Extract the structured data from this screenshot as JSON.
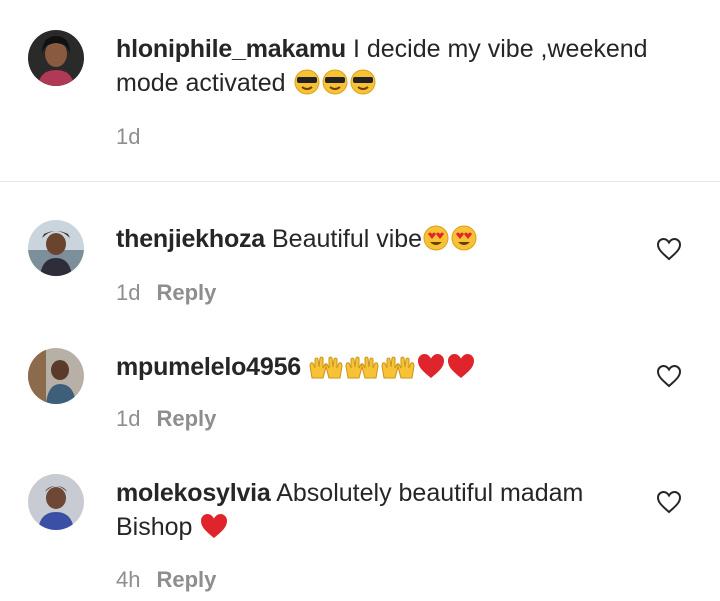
{
  "comments": [
    {
      "username": "hloniphile_makamu",
      "text": "I decide my vibe ,weekend",
      "text_line2": "mode activated",
      "emojis": [
        "sunglasses-emoji",
        "sunglasses-emoji",
        "sunglasses-emoji"
      ],
      "time": "1d",
      "reply": ""
    },
    {
      "username": "thenjiekhoza",
      "text": "Beautiful vibe",
      "emojis": [
        "heart-eyes-emoji",
        "heart-eyes-emoji"
      ],
      "time": "1d",
      "reply": "Reply"
    },
    {
      "username": "mpumelelo4956",
      "text": "",
      "emojis": [
        "raising-hands-emoji",
        "raising-hands-emoji",
        "raising-hands-emoji",
        "red-heart-emoji",
        "red-heart-emoji"
      ],
      "time": "1d",
      "reply": "Reply"
    },
    {
      "username": "molekosylvia",
      "text": "Absolutely beautiful madam",
      "text_line2": "Bishop",
      "emojis": [
        "red-heart-emoji"
      ],
      "time": "4h",
      "reply": "Reply"
    }
  ],
  "icons": {
    "like": "heart-outline-icon"
  },
  "colors": {
    "text": "#262626",
    "secondary": "#8e8e8e",
    "divider": "#e6e6e6",
    "emoji_yellow": "#f7c235",
    "emoji_red": "#e0242b"
  }
}
